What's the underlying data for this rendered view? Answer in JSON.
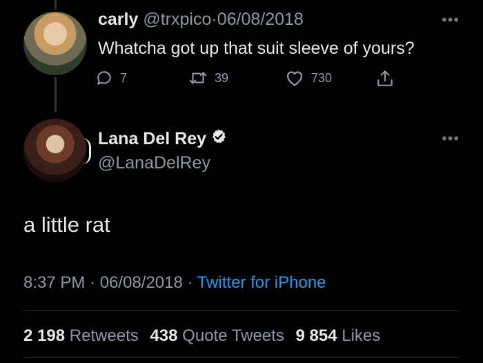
{
  "reply": {
    "display_name": "carly",
    "handle": "@trxpico",
    "separator": "·",
    "date": "06/08/2018",
    "text": "Whatcha got up that suit sleeve of yours?",
    "more_icon": "more-dots-icon",
    "actions": {
      "reply_icon": "reply-bubble-icon",
      "reply_count": "7",
      "retweet_icon": "retweet-icon",
      "retweet_count": "39",
      "like_icon": "heart-icon",
      "like_count": "730",
      "share_icon": "share-icon"
    }
  },
  "tweet": {
    "display_name": "Lana Del Rey",
    "verified_icon": "verified-badge-icon",
    "handle": "@LanaDelRey",
    "more_icon": "more-dots-icon",
    "text": "a little rat",
    "time": "8:37 PM",
    "separator": "·",
    "date": "06/08/2018",
    "source": "Twitter for iPhone",
    "stats": {
      "retweets_count": "2 198",
      "retweets_label": "Retweets",
      "quotes_count": "438",
      "quotes_label": "Quote Tweets",
      "likes_count": "9 854",
      "likes_label": "Likes"
    }
  },
  "colors": {
    "background": "#000000",
    "primary_text": "#e7e9ea",
    "secondary_text": "#8b98a5",
    "link_blue": "#1d9bf0",
    "divider": "#2f3336"
  }
}
